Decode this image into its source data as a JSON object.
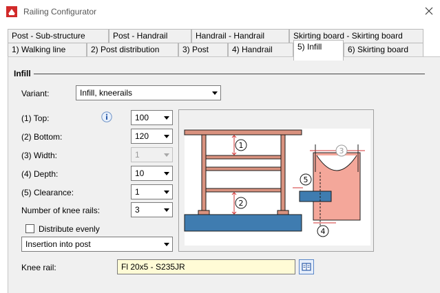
{
  "window": {
    "title": "Railing Configurator"
  },
  "tabs_row1": [
    "Post - Sub-structure",
    "Post - Handrail",
    "Handrail - Handrail",
    "Skirting board - Skirting board"
  ],
  "tabs_row2": [
    "1) Walking line",
    "2) Post distribution",
    "3) Post",
    "4) Handrail",
    "5) Infill",
    "6) Skirting board"
  ],
  "active_tab": "5) Infill",
  "group": {
    "title": "Infill"
  },
  "variant": {
    "label": "Variant:",
    "value": "Infill, kneerails"
  },
  "fields": {
    "top": {
      "label": "(1) Top:",
      "value": "100"
    },
    "bottom": {
      "label": "(2) Bottom:",
      "value": "120"
    },
    "width": {
      "label": "(3) Width:",
      "value": "1"
    },
    "depth": {
      "label": "(4) Depth:",
      "value": "10"
    },
    "clearance": {
      "label": "(5) Clearance:",
      "value": "1"
    },
    "knee_count": {
      "label": "Number of knee rails:",
      "value": "3"
    }
  },
  "distribute": {
    "label": "Distribute evenly",
    "checked": false
  },
  "insertion": {
    "value": "Insertion into post"
  },
  "knee_rail": {
    "label": "Knee rail:",
    "value": "Fl 20x5 - S235JR"
  },
  "diagram": {
    "callouts": [
      "1",
      "2",
      "3",
      "4",
      "5"
    ]
  },
  "colors": {
    "rail": "#d9927f",
    "beam": "#3f7cb0",
    "infill": "#f4a79a",
    "accent": "#d03030"
  }
}
